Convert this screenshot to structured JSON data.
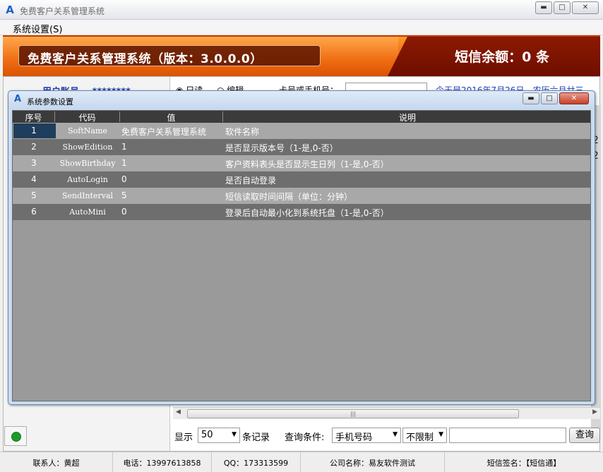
{
  "window": {
    "title": "免费客户关系管理系统",
    "min_label": "▭",
    "max_label": "□",
    "close_label": "✕"
  },
  "menu": {
    "items": [
      {
        "label": "系统设置(S)"
      }
    ]
  },
  "banner": {
    "app_name": "免费客户关系管理系统（版本：3.0.0.0）",
    "sms_balance": "短信余额：0 条"
  },
  "main": {
    "account_label": "用户账号",
    "account_value": "********",
    "mode_read": "只读",
    "mode_edit": "编辑",
    "card_label": "卡号或手机号：",
    "today_text": "今天是2016年7月26日，农历六月廿三",
    "right_digits": [
      "2",
      "2"
    ]
  },
  "dialog": {
    "title": "系统参数设置",
    "columns": [
      "序号",
      "代码",
      "值",
      "说明"
    ],
    "rows": [
      {
        "seq": "1",
        "code": "SoftName",
        "value": "免费客户关系管理系统",
        "desc": "软件名称"
      },
      {
        "seq": "2",
        "code": "ShowEdition",
        "value": "1",
        "desc": "是否显示版本号（1-是,0-否）"
      },
      {
        "seq": "3",
        "code": "ShowBirthday",
        "value": "1",
        "desc": "客户资料表头是否显示生日列（1-是,0-否）"
      },
      {
        "seq": "4",
        "code": "AutoLogin",
        "value": "0",
        "desc": "是否自动登录"
      },
      {
        "seq": "5",
        "code": "SendInterval",
        "value": "5",
        "desc": "短信读取时间间隔（单位：分钟）"
      },
      {
        "seq": "6",
        "code": "AutoMini",
        "value": "0",
        "desc": "登录后自动最小化到系统托盘（1-是,0-否）"
      }
    ]
  },
  "bottom": {
    "show_label": "显示",
    "page_size": "50",
    "records_label": "条记录",
    "query_label": "查询条件:",
    "field_select": "手机号码",
    "limit_select": "不限制",
    "query_button": "查询"
  },
  "status": {
    "contact": "联系人：黄超",
    "phone": "电话：13997613858",
    "qq": "QQ：173313599",
    "company": "公司名称：易友软件测试",
    "signature": "短信签名：【短信通】"
  },
  "colors": {
    "banner_orange": "#ef6c12",
    "banner_dark": "#6f0e00",
    "link_blue": "#1f3fbf",
    "status_green": "#1f9a2a"
  }
}
